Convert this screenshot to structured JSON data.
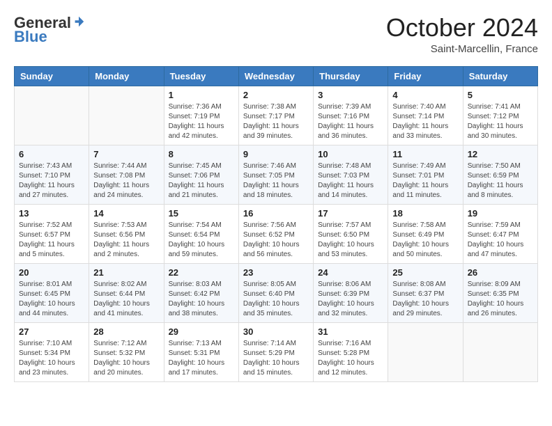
{
  "header": {
    "logo": {
      "general": "General",
      "blue": "Blue"
    },
    "title": "October 2024",
    "location": "Saint-Marcellin, France"
  },
  "weekdays": [
    "Sunday",
    "Monday",
    "Tuesday",
    "Wednesday",
    "Thursday",
    "Friday",
    "Saturday"
  ],
  "weeks": [
    [
      {
        "day": "",
        "sunrise": "",
        "sunset": "",
        "daylight": ""
      },
      {
        "day": "",
        "sunrise": "",
        "sunset": "",
        "daylight": ""
      },
      {
        "day": "1",
        "sunrise": "Sunrise: 7:36 AM",
        "sunset": "Sunset: 7:19 PM",
        "daylight": "Daylight: 11 hours and 42 minutes."
      },
      {
        "day": "2",
        "sunrise": "Sunrise: 7:38 AM",
        "sunset": "Sunset: 7:17 PM",
        "daylight": "Daylight: 11 hours and 39 minutes."
      },
      {
        "day": "3",
        "sunrise": "Sunrise: 7:39 AM",
        "sunset": "Sunset: 7:16 PM",
        "daylight": "Daylight: 11 hours and 36 minutes."
      },
      {
        "day": "4",
        "sunrise": "Sunrise: 7:40 AM",
        "sunset": "Sunset: 7:14 PM",
        "daylight": "Daylight: 11 hours and 33 minutes."
      },
      {
        "day": "5",
        "sunrise": "Sunrise: 7:41 AM",
        "sunset": "Sunset: 7:12 PM",
        "daylight": "Daylight: 11 hours and 30 minutes."
      }
    ],
    [
      {
        "day": "6",
        "sunrise": "Sunrise: 7:43 AM",
        "sunset": "Sunset: 7:10 PM",
        "daylight": "Daylight: 11 hours and 27 minutes."
      },
      {
        "day": "7",
        "sunrise": "Sunrise: 7:44 AM",
        "sunset": "Sunset: 7:08 PM",
        "daylight": "Daylight: 11 hours and 24 minutes."
      },
      {
        "day": "8",
        "sunrise": "Sunrise: 7:45 AM",
        "sunset": "Sunset: 7:06 PM",
        "daylight": "Daylight: 11 hours and 21 minutes."
      },
      {
        "day": "9",
        "sunrise": "Sunrise: 7:46 AM",
        "sunset": "Sunset: 7:05 PM",
        "daylight": "Daylight: 11 hours and 18 minutes."
      },
      {
        "day": "10",
        "sunrise": "Sunrise: 7:48 AM",
        "sunset": "Sunset: 7:03 PM",
        "daylight": "Daylight: 11 hours and 14 minutes."
      },
      {
        "day": "11",
        "sunrise": "Sunrise: 7:49 AM",
        "sunset": "Sunset: 7:01 PM",
        "daylight": "Daylight: 11 hours and 11 minutes."
      },
      {
        "day": "12",
        "sunrise": "Sunrise: 7:50 AM",
        "sunset": "Sunset: 6:59 PM",
        "daylight": "Daylight: 11 hours and 8 minutes."
      }
    ],
    [
      {
        "day": "13",
        "sunrise": "Sunrise: 7:52 AM",
        "sunset": "Sunset: 6:57 PM",
        "daylight": "Daylight: 11 hours and 5 minutes."
      },
      {
        "day": "14",
        "sunrise": "Sunrise: 7:53 AM",
        "sunset": "Sunset: 6:56 PM",
        "daylight": "Daylight: 11 hours and 2 minutes."
      },
      {
        "day": "15",
        "sunrise": "Sunrise: 7:54 AM",
        "sunset": "Sunset: 6:54 PM",
        "daylight": "Daylight: 10 hours and 59 minutes."
      },
      {
        "day": "16",
        "sunrise": "Sunrise: 7:56 AM",
        "sunset": "Sunset: 6:52 PM",
        "daylight": "Daylight: 10 hours and 56 minutes."
      },
      {
        "day": "17",
        "sunrise": "Sunrise: 7:57 AM",
        "sunset": "Sunset: 6:50 PM",
        "daylight": "Daylight: 10 hours and 53 minutes."
      },
      {
        "day": "18",
        "sunrise": "Sunrise: 7:58 AM",
        "sunset": "Sunset: 6:49 PM",
        "daylight": "Daylight: 10 hours and 50 minutes."
      },
      {
        "day": "19",
        "sunrise": "Sunrise: 7:59 AM",
        "sunset": "Sunset: 6:47 PM",
        "daylight": "Daylight: 10 hours and 47 minutes."
      }
    ],
    [
      {
        "day": "20",
        "sunrise": "Sunrise: 8:01 AM",
        "sunset": "Sunset: 6:45 PM",
        "daylight": "Daylight: 10 hours and 44 minutes."
      },
      {
        "day": "21",
        "sunrise": "Sunrise: 8:02 AM",
        "sunset": "Sunset: 6:44 PM",
        "daylight": "Daylight: 10 hours and 41 minutes."
      },
      {
        "day": "22",
        "sunrise": "Sunrise: 8:03 AM",
        "sunset": "Sunset: 6:42 PM",
        "daylight": "Daylight: 10 hours and 38 minutes."
      },
      {
        "day": "23",
        "sunrise": "Sunrise: 8:05 AM",
        "sunset": "Sunset: 6:40 PM",
        "daylight": "Daylight: 10 hours and 35 minutes."
      },
      {
        "day": "24",
        "sunrise": "Sunrise: 8:06 AM",
        "sunset": "Sunset: 6:39 PM",
        "daylight": "Daylight: 10 hours and 32 minutes."
      },
      {
        "day": "25",
        "sunrise": "Sunrise: 8:08 AM",
        "sunset": "Sunset: 6:37 PM",
        "daylight": "Daylight: 10 hours and 29 minutes."
      },
      {
        "day": "26",
        "sunrise": "Sunrise: 8:09 AM",
        "sunset": "Sunset: 6:35 PM",
        "daylight": "Daylight: 10 hours and 26 minutes."
      }
    ],
    [
      {
        "day": "27",
        "sunrise": "Sunrise: 7:10 AM",
        "sunset": "Sunset: 5:34 PM",
        "daylight": "Daylight: 10 hours and 23 minutes."
      },
      {
        "day": "28",
        "sunrise": "Sunrise: 7:12 AM",
        "sunset": "Sunset: 5:32 PM",
        "daylight": "Daylight: 10 hours and 20 minutes."
      },
      {
        "day": "29",
        "sunrise": "Sunrise: 7:13 AM",
        "sunset": "Sunset: 5:31 PM",
        "daylight": "Daylight: 10 hours and 17 minutes."
      },
      {
        "day": "30",
        "sunrise": "Sunrise: 7:14 AM",
        "sunset": "Sunset: 5:29 PM",
        "daylight": "Daylight: 10 hours and 15 minutes."
      },
      {
        "day": "31",
        "sunrise": "Sunrise: 7:16 AM",
        "sunset": "Sunset: 5:28 PM",
        "daylight": "Daylight: 10 hours and 12 minutes."
      },
      {
        "day": "",
        "sunrise": "",
        "sunset": "",
        "daylight": ""
      },
      {
        "day": "",
        "sunrise": "",
        "sunset": "",
        "daylight": ""
      }
    ]
  ]
}
